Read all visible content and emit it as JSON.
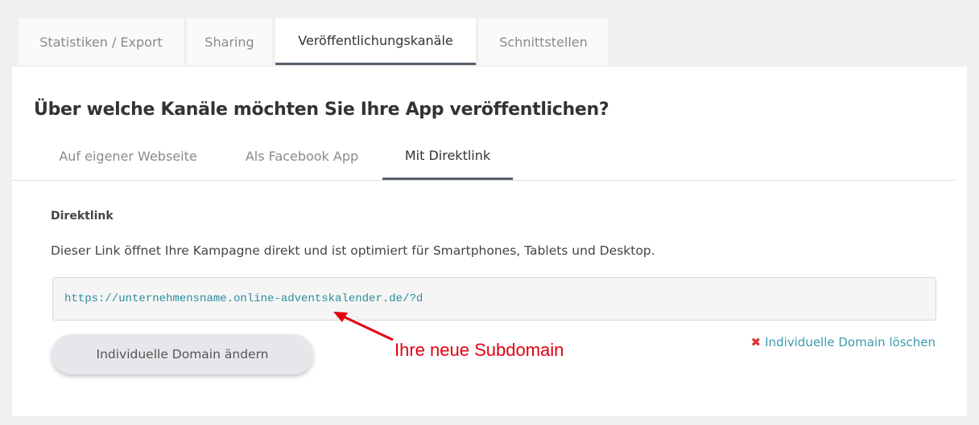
{
  "top_tabs": [
    {
      "label": "Statistiken / Export",
      "active": false
    },
    {
      "label": "Sharing",
      "active": false
    },
    {
      "label": "Veröffentlichungskanäle",
      "active": true
    },
    {
      "label": "Schnittstellen",
      "active": false
    }
  ],
  "panel": {
    "heading": "Über welche Kanäle möchten Sie Ihre App veröffentlichen?",
    "sub_tabs": [
      {
        "label": "Auf eigener Webseite",
        "active": false
      },
      {
        "label": "Als Facebook App",
        "active": false
      },
      {
        "label": "Mit Direktlink",
        "active": true
      }
    ],
    "section_title": "Direktlink",
    "description": "Dieser Link öffnet Ihre Kampagne direkt und ist optimiert für Smartphones, Tablets und Desktop.",
    "link_value": "https://unternehmensname.online-adventskalender.de/?d",
    "change_button_label": "Individuelle Domain ändern",
    "delete_link_label": "Individuelle Domain löschen",
    "delete_icon": "x-icon"
  },
  "annotation": {
    "text": "Ihre neue Subdomain",
    "color": "#e3000f"
  },
  "colors": {
    "link_text": "#2a8d9c",
    "delete_link": "#3b9ab0",
    "delete_icon": "#d8352d",
    "active_tab_border": "#555f6b"
  }
}
